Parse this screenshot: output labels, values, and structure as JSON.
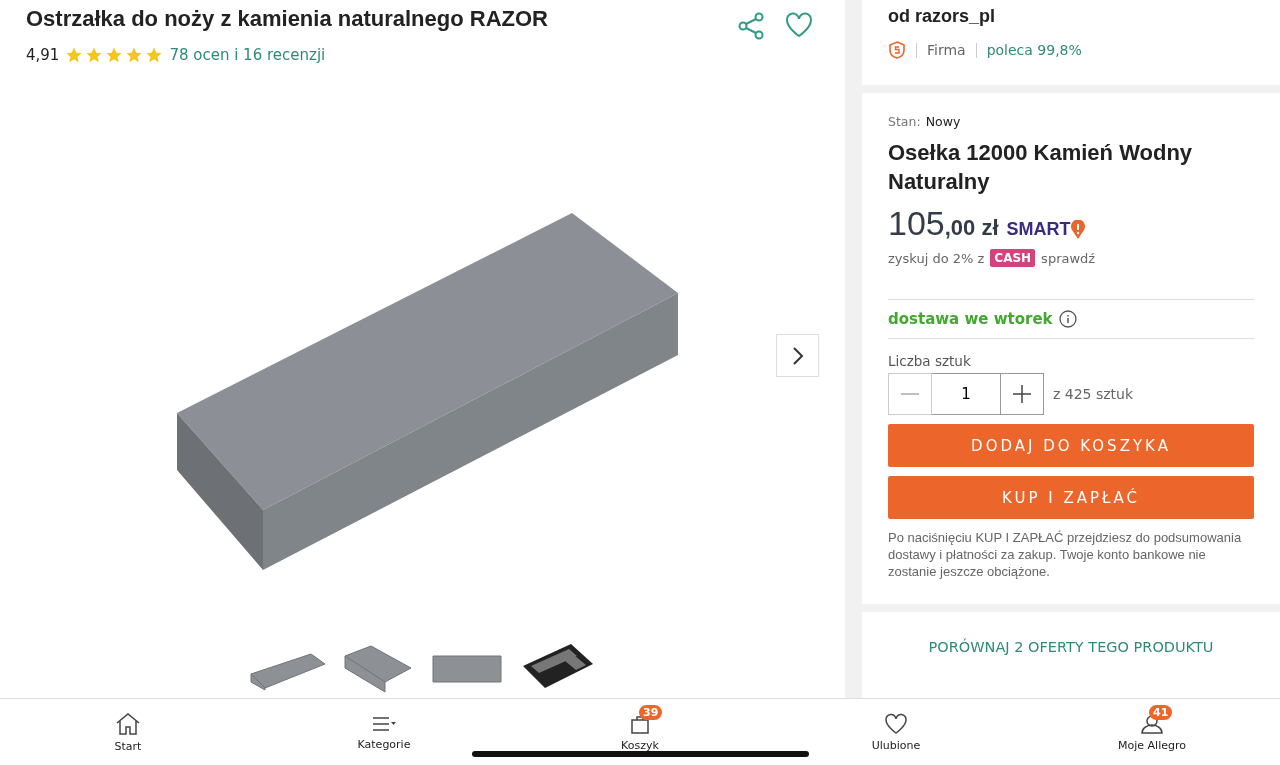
{
  "product": {
    "title": "Ostrzałka do noży z kamienia naturalnego RAZOR",
    "rating": "4,91",
    "stars": 5,
    "reviews": "78 ocen i 16 recenzji",
    "thumbnails": [
      {
        "kind": "stone"
      },
      {
        "kind": "stone"
      },
      {
        "kind": "stone"
      },
      {
        "kind": "tray"
      }
    ]
  },
  "seller": {
    "name": "od razors_pl",
    "type": "Firma",
    "recommend": "poleca 99,8%"
  },
  "offer": {
    "condition_label": "Stan:",
    "condition": "Nowy",
    "title": "Osełka 12000 Kamień Wodny Naturalny",
    "price_main": "105",
    "price_cents": ",00 zł",
    "smart": "SMART",
    "cashback": "zyskuj do 2% z",
    "cash_badge": "CASH",
    "cash_link": "sprawdź",
    "delivery": "dostawa we wtorek",
    "qty_label": "Liczba sztuk",
    "qty": "1",
    "qty_max": "z 425 sztuk",
    "buttons": [
      "DODAJ DO KOSZYKA",
      "KUP I ZAPŁAĆ"
    ],
    "note": "Po naciśnięciu KUP I ZAPŁAĆ przejdziesz do podsumowania dostawy i płatności za zakup. Twoje konto bankowe nie zostanie jeszcze obciążone."
  },
  "compare": "PORÓWNAJ 2 OFERTY TEGO PRODUKTU",
  "nav": [
    {
      "kind": "home",
      "label": "Start"
    },
    {
      "kind": "menu",
      "label": "Kategorie"
    },
    {
      "kind": "cart",
      "label": "Koszyk",
      "badge": "39"
    },
    {
      "kind": "heart",
      "label": "Ulubione"
    },
    {
      "kind": "user",
      "label": "Moje Allegro",
      "badge": "41"
    }
  ]
}
